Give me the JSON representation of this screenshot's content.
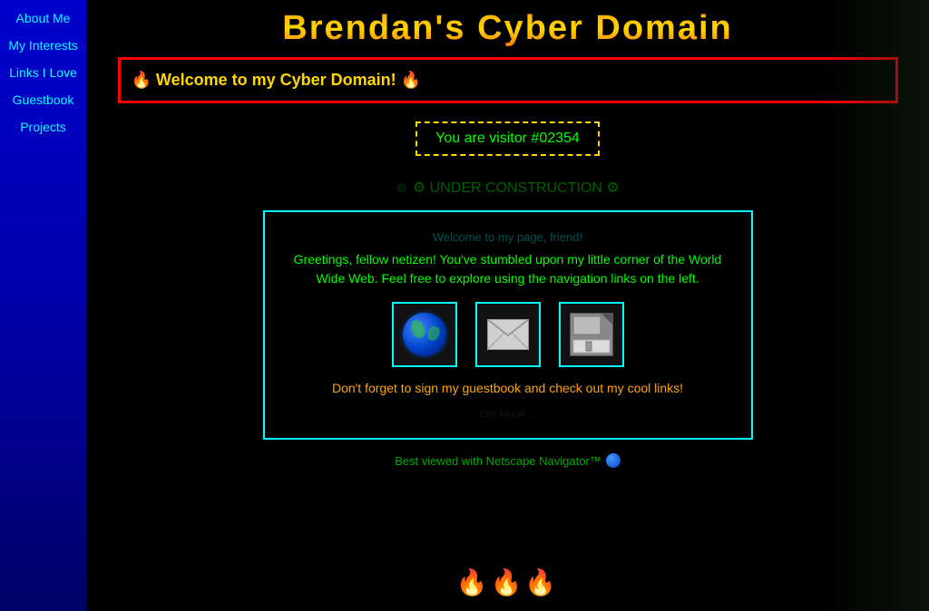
{
  "site": {
    "title": "Brendan's Cyber Domain",
    "title_style": "gradient-orange-gold"
  },
  "sidebar": {
    "background_color": "#0000cc",
    "items": [
      {
        "label": "About Me",
        "href": "#about"
      },
      {
        "label": "My Interests",
        "href": "#interests"
      },
      {
        "label": "Links I Love",
        "href": "#links"
      },
      {
        "label": "Guestbook",
        "href": "#guestbook"
      },
      {
        "label": "Projects",
        "href": "#projects"
      }
    ]
  },
  "welcome_banner": {
    "text": "🔥 Welcome to my Cyber Domain! 🔥",
    "border_color": "red"
  },
  "visitor": {
    "label": "You are visitor #02354"
  },
  "construction": {
    "text": "⚙ UNDER CONSTRUCTION ⚙"
  },
  "content_box": {
    "subtitle": "Welcome to my page, friend!",
    "greetings": "Greetings, fellow netizen! You've stumbled upon my little corner of the World Wide Web. Feel free to explore using the navigation links on the left.",
    "icons": [
      {
        "type": "globe",
        "label": "Globe icon"
      },
      {
        "type": "mail",
        "label": "Mail icon"
      },
      {
        "type": "floppy",
        "label": "Floppy disk icon"
      }
    ],
    "guestbook_prompt": "Don't forget to sign my guestbook and check out my cool links!",
    "edit_mode": "Edit Mode ..."
  },
  "footer": {
    "best_viewed": "Best viewed with Netscape Navigator™",
    "bottom_flames": "🔥🔥🔥"
  },
  "colors": {
    "background": "#000000",
    "sidebar_bg": "#0000cc",
    "nav_link": "#00ffff",
    "title_gradient_start": "#ff8c00",
    "title_gradient_end": "#ff4500",
    "welcome_text": "#ffd700",
    "visitor_text": "#00ff00",
    "construction_text": "#008800",
    "content_border": "#00ffff",
    "greetings_text": "#00ff00",
    "guestbook_text": "#ffa500",
    "best_viewed_text": "#00aa00"
  }
}
